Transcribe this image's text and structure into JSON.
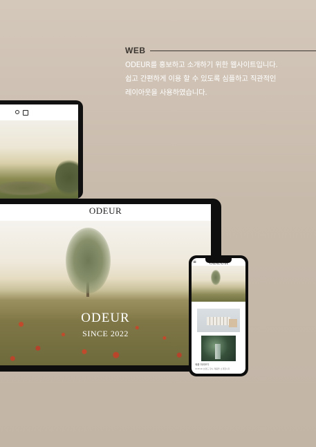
{
  "section": {
    "label": "WEB",
    "description_lines": [
      "ODEUR를 홍보하고 소개하기 위한 웹사이트입니다.",
      "쉽고 간편하게 이용 할 수 있도록 심플하고 직관적인",
      "레이아웃을 사용하였습니다."
    ]
  },
  "laptop": {
    "icons": [
      "user-icon",
      "shopping-bag-icon"
    ]
  },
  "tablet": {
    "logo": "ODEUR",
    "hero_title": "ODEUR",
    "hero_subtitle": "SINCE 2022"
  },
  "phone": {
    "menu_icon": "≡",
    "logo": "ODEUR",
    "caption_title": "제품 미리보기",
    "caption_text": "ODEUR 브랜드 향수 제품을 소개합니다"
  },
  "colors": {
    "background": "#c9bcae",
    "text_dark": "#3b3530",
    "text_light": "#ffffff",
    "device_frame": "#0e0e0e"
  }
}
